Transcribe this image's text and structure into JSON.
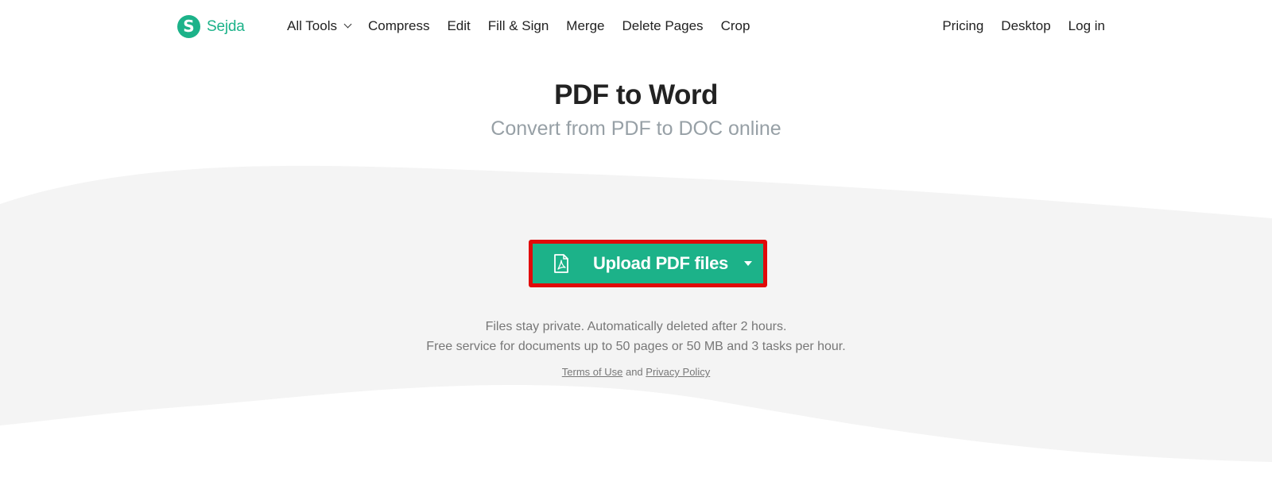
{
  "brand": {
    "logo_letter": "S",
    "name": "Sejda",
    "accent_color": "#1cb289"
  },
  "nav": {
    "left": [
      {
        "label": "All Tools",
        "has_dropdown": true
      },
      {
        "label": "Compress"
      },
      {
        "label": "Edit"
      },
      {
        "label": "Fill & Sign"
      },
      {
        "label": "Merge"
      },
      {
        "label": "Delete Pages"
      },
      {
        "label": "Crop"
      }
    ],
    "right": [
      {
        "label": "Pricing"
      },
      {
        "label": "Desktop"
      },
      {
        "label": "Log in"
      }
    ]
  },
  "hero": {
    "title": "PDF to Word",
    "subtitle": "Convert from PDF to DOC online"
  },
  "upload": {
    "label": "Upload PDF files",
    "icon": "pdf-file-icon",
    "highlight_color": "#e10909"
  },
  "info": {
    "line1": "Files stay private. Automatically deleted after 2 hours.",
    "line2": "Free service for documents up to 50 pages or 50 MB and 3 tasks per hour."
  },
  "legal": {
    "terms": "Terms of Use",
    "and": "and",
    "privacy": "Privacy Policy"
  }
}
